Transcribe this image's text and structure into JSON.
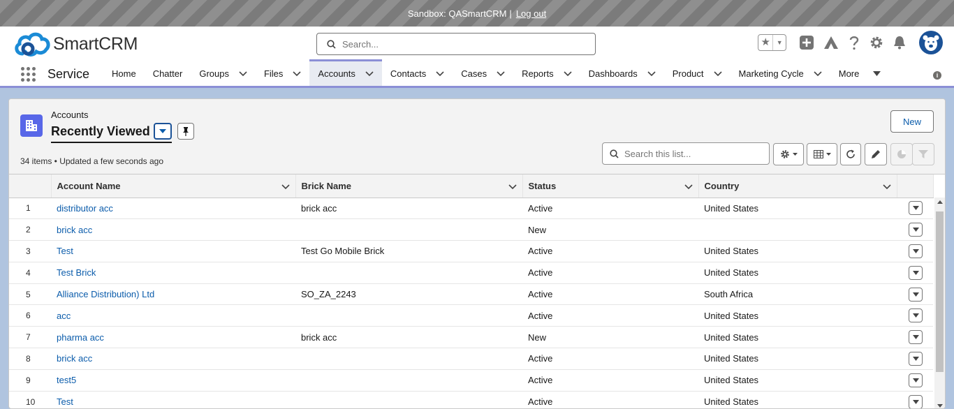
{
  "sandbox": {
    "text": "Sandbox: QASmartCRM",
    "separator": "|",
    "logout": "Log out"
  },
  "header": {
    "brand": "SmartCRM",
    "search_placeholder": "Search..."
  },
  "nav": {
    "app_name": "Service",
    "tabs": [
      {
        "label": "Home",
        "has_menu": false
      },
      {
        "label": "Chatter",
        "has_menu": false
      },
      {
        "label": "Groups",
        "has_menu": true
      },
      {
        "label": "Files",
        "has_menu": true
      },
      {
        "label": "Accounts",
        "has_menu": true,
        "active": true
      },
      {
        "label": "Contacts",
        "has_menu": true
      },
      {
        "label": "Cases",
        "has_menu": true
      },
      {
        "label": "Reports",
        "has_menu": true
      },
      {
        "label": "Dashboards",
        "has_menu": true
      },
      {
        "label": "Product",
        "has_menu": true
      },
      {
        "label": "Marketing Cycle",
        "has_menu": true
      },
      {
        "label": "More",
        "has_menu": true
      }
    ]
  },
  "list": {
    "object_type": "Accounts",
    "view_name": "Recently Viewed",
    "new_button": "New",
    "meta": "34 items • Updated a few seconds ago",
    "search_placeholder": "Search this list...",
    "columns": [
      "Account Name",
      "Brick Name",
      "Status",
      "Country"
    ],
    "rows": [
      {
        "n": "1",
        "account": "distributor acc",
        "brick": "brick acc",
        "status": "Active",
        "country": "United States"
      },
      {
        "n": "2",
        "account": "brick acc",
        "brick": "",
        "status": "New",
        "country": ""
      },
      {
        "n": "3",
        "account": "Test",
        "brick": "Test Go Mobile Brick",
        "status": "Active",
        "country": "United States"
      },
      {
        "n": "4",
        "account": "Test Brick",
        "brick": "",
        "status": "Active",
        "country": "United States"
      },
      {
        "n": "5",
        "account": "Alliance Distribution) Ltd",
        "brick": "SO_ZA_2243",
        "status": "Active",
        "country": "South Africa"
      },
      {
        "n": "6",
        "account": "acc",
        "brick": "",
        "status": "Active",
        "country": "United States"
      },
      {
        "n": "7",
        "account": "pharma acc",
        "brick": "brick acc",
        "status": "New",
        "country": "United States"
      },
      {
        "n": "8",
        "account": "brick acc",
        "brick": "",
        "status": "Active",
        "country": "United States"
      },
      {
        "n": "9",
        "account": "test5",
        "brick": "",
        "status": "Active",
        "country": "United States"
      },
      {
        "n": "10",
        "account": "Test",
        "brick": "",
        "status": "Active",
        "country": "United States"
      }
    ]
  },
  "colors": {
    "link": "#0b5cab",
    "accent": "#8b8fd6",
    "object_icon": "#5867e8",
    "brand": "#1b5297"
  }
}
